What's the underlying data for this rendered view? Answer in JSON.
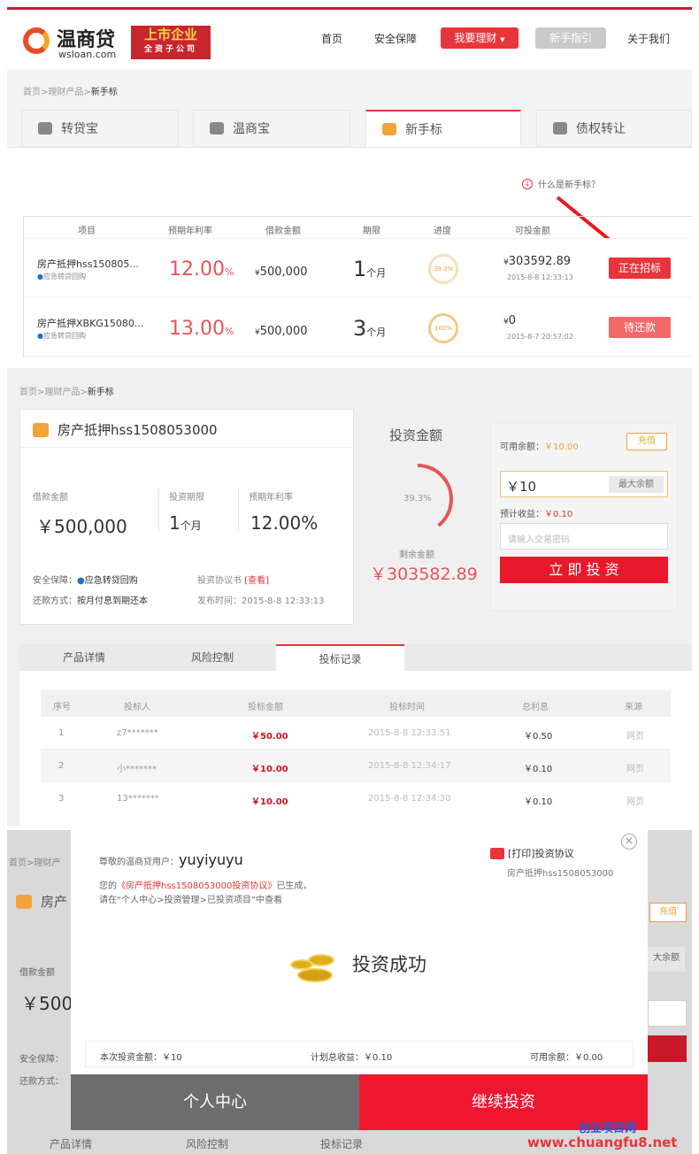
{
  "header": {
    "logo_text": "温商贷",
    "logo_sub": "wsloan.com",
    "badge_main": "上市企业",
    "badge_sub": "全资子公司",
    "nav": [
      "首页",
      "安全保障",
      "我要理财",
      "新手指引",
      "关于我们"
    ],
    "dropdown_caret": "▼"
  },
  "breadcrumb": {
    "home": "首页",
    "sep": ">",
    "category": "理财产品",
    "current": "新手标"
  },
  "product_tabs": [
    "转贷宝",
    "温商宝",
    "新手标",
    "债权转让"
  ],
  "help_link": "什么是新手标？",
  "list": {
    "headers": [
      "项目",
      "预期年利率",
      "借款金额",
      "期限",
      "进度",
      "可投金额"
    ],
    "rows": [
      {
        "name": "房产抵押hss150805...",
        "guarantee": "应急转贷回购",
        "rate": "12.00",
        "pct": "%",
        "amount": "500,000",
        "term": "1",
        "unit": "个月",
        "progress": "39.3%",
        "available": "303592.89",
        "date": "2015-8-8 12:33:13",
        "status": "正在招标",
        "status_color": "#e8353b"
      },
      {
        "name": "房产抵押XBKG15080...",
        "guarantee": "应急转贷回购",
        "rate": "13.00",
        "pct": "%",
        "amount": "500,000",
        "term": "3",
        "unit": "个月",
        "progress": "100%",
        "available": "0",
        "date": "2015-8-7 20:57:02",
        "status": "待还款",
        "status_color": "#f06a6a"
      }
    ],
    "currency_symbol": "¥"
  },
  "detail": {
    "title": "房产抵押hss1508053000",
    "loan_label": "借款金额",
    "loan_value": "￥500,000",
    "term_label": "投资期限",
    "term_value": "1",
    "term_unit": "个月",
    "rate_label": "预期年利率",
    "rate_value": "12.00%",
    "safety_label": "安全保障：",
    "safety_value": "应急转贷回购",
    "contract_label": "投资协议书",
    "contract_link": "[查看]",
    "repay_label": "还款方式：",
    "repay_value": "按月付息到期还本",
    "publish_label": "发布时间：",
    "publish_value": "2015-8-8 12:33:13",
    "invest_title": "投资金额",
    "ring_pct": "39.3%",
    "progress": 0.393,
    "remaining_label": "剩余金额",
    "remaining_value": "￥303582.89",
    "balance_label": "可用余额：",
    "balance_value": "￥10.00",
    "recharge": "充值",
    "amount_input": "￥10",
    "max_button": "最大余额",
    "expected_label": "预计收益：",
    "expected_value": "￥0.10",
    "password_placeholder": "请输入交易密码",
    "invest_button": "立 即 投 资"
  },
  "bottom_tabs": [
    "产品详情",
    "风险控制",
    "投标记录"
  ],
  "records": {
    "headers": [
      "序号",
      "投标人",
      "投标金额",
      "投标时间",
      "总利息",
      "来源"
    ],
    "rows": [
      [
        "1",
        "z7*******",
        "￥50.00",
        "2015-8-8 12:33:51",
        "￥0.50",
        "网页"
      ],
      [
        "2",
        "小*******",
        "￥10.00",
        "2015-8-8 12:34:17",
        "￥0.10",
        "网页"
      ],
      [
        "3",
        "13*******",
        "￥10.00",
        "2015-8-8 12:34:30",
        "￥0.10",
        "网页"
      ]
    ]
  },
  "modal": {
    "greeting": "尊敬的温商贷用户：",
    "username": "yuyiyuyu",
    "line1_pre": "您的",
    "line1_link": "《房产抵押hss1508053000投资协议》",
    "line1_post": "已生成，",
    "line2": "请在“个人中心>投资管理>已投资项目”中查看",
    "print_label": "[打印]投资协议",
    "print_sub": "房产抵押hss1508053000",
    "success": "投资成功",
    "this_invest": "本次投资金额：￥10",
    "total_income": "计划总收益：￥0.10",
    "balance": "可用余额：￥0.00",
    "btn_center": "个人中心",
    "btn_continue": "继续投资",
    "close": "×"
  },
  "background_fragments": {
    "crumb": "首页>理财产",
    "title": "房产",
    "recharge": "充值",
    "max": "大余额",
    "loan_label": "借款金额",
    "loan_value": "￥500",
    "safety": "安全保障：",
    "repay": "还款方式：",
    "tab1": "产品详情",
    "tab2": "风险控制",
    "tab3": "投标记录"
  },
  "watermark": {
    "cn": "创业项目网",
    "url": "www.chuangfu8.net"
  }
}
